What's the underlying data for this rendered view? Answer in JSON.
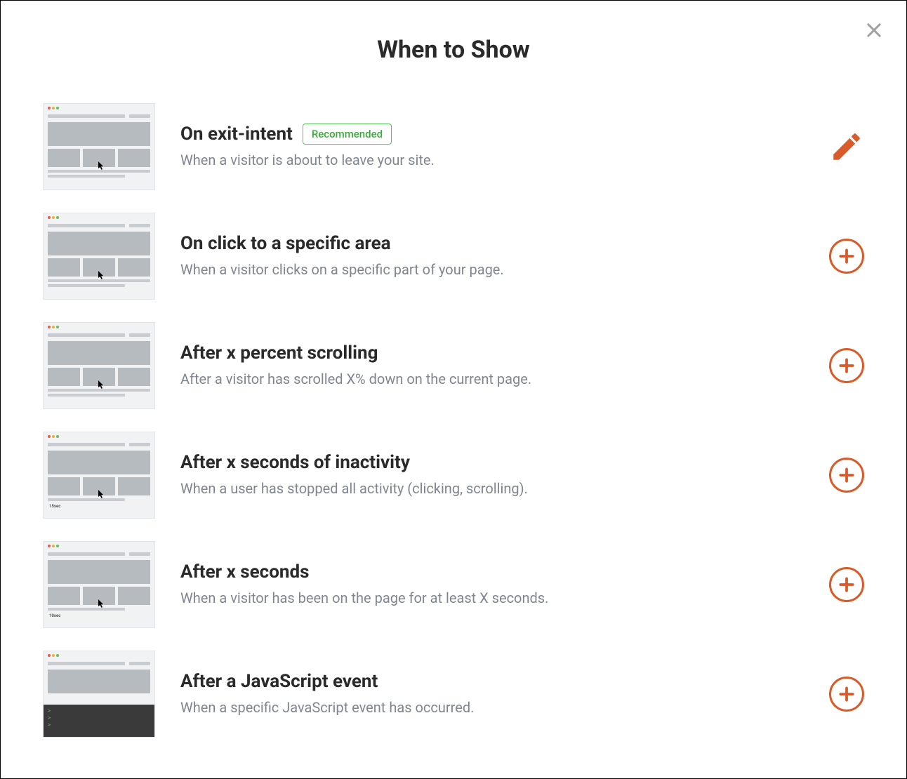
{
  "modal": {
    "title": "When to Show"
  },
  "badge": {
    "recommended": "Recommended"
  },
  "rules": [
    {
      "id": "exit-intent",
      "title": "On exit-intent",
      "description": "When a visitor is about to leave your site.",
      "recommended": true,
      "action": "edit"
    },
    {
      "id": "click-area",
      "title": "On click to a specific area",
      "description": "When a visitor clicks on a specific part of your page.",
      "recommended": false,
      "action": "add"
    },
    {
      "id": "percent-scroll",
      "title": "After x percent scrolling",
      "description": "After a visitor has scrolled X% down on the current page.",
      "recommended": false,
      "action": "add"
    },
    {
      "id": "inactivity",
      "title": "After x seconds of inactivity",
      "description": "When a user has stopped all activity (clicking, scrolling).",
      "recommended": false,
      "action": "add",
      "tiny_label": "15sec"
    },
    {
      "id": "seconds",
      "title": "After x seconds",
      "description": "When a visitor has been on the page for at least X seconds.",
      "recommended": false,
      "action": "add",
      "tiny_label": "10sec"
    },
    {
      "id": "js-event",
      "title": "After a JavaScript event",
      "description": "When a specific JavaScript event has occurred.",
      "recommended": false,
      "action": "add"
    }
  ]
}
